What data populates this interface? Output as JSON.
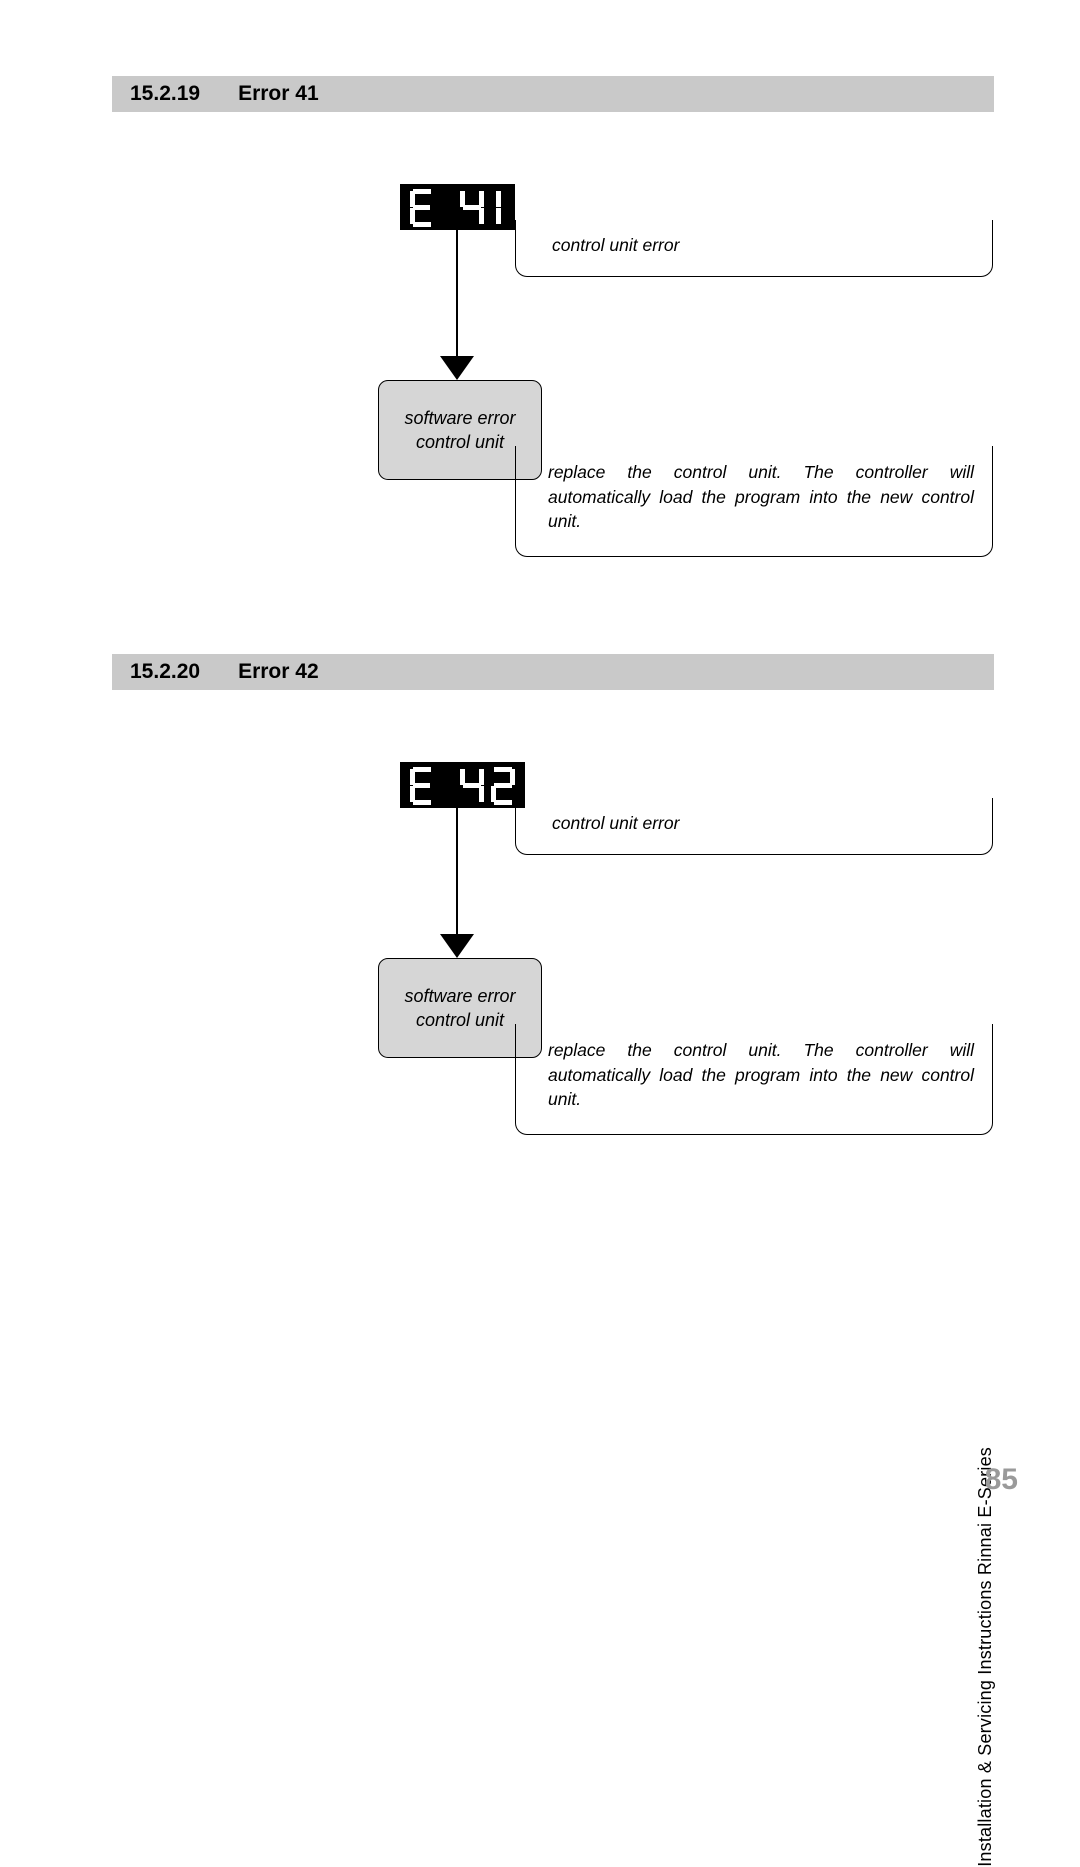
{
  "section1": {
    "number": "15.2.19",
    "title": "Error 41",
    "display_code": "E  41",
    "callout_text": "control unit error",
    "sw_box_line1": "software error",
    "sw_box_line2": "control unit",
    "instruction": "replace the control unit. The controller will automatically load the program into the new control unit."
  },
  "section2": {
    "number": "15.2.20",
    "title": "Error 42",
    "display_code": "E  42",
    "callout_text": "control unit error",
    "sw_box_line1": "software error",
    "sw_box_line2": "control unit",
    "instruction": "replace the control unit. The controller will automatically load the program into the new control unit."
  },
  "side_text": "Installation & Servicing Instructions Rinnai E-Series",
  "page_number": "85"
}
